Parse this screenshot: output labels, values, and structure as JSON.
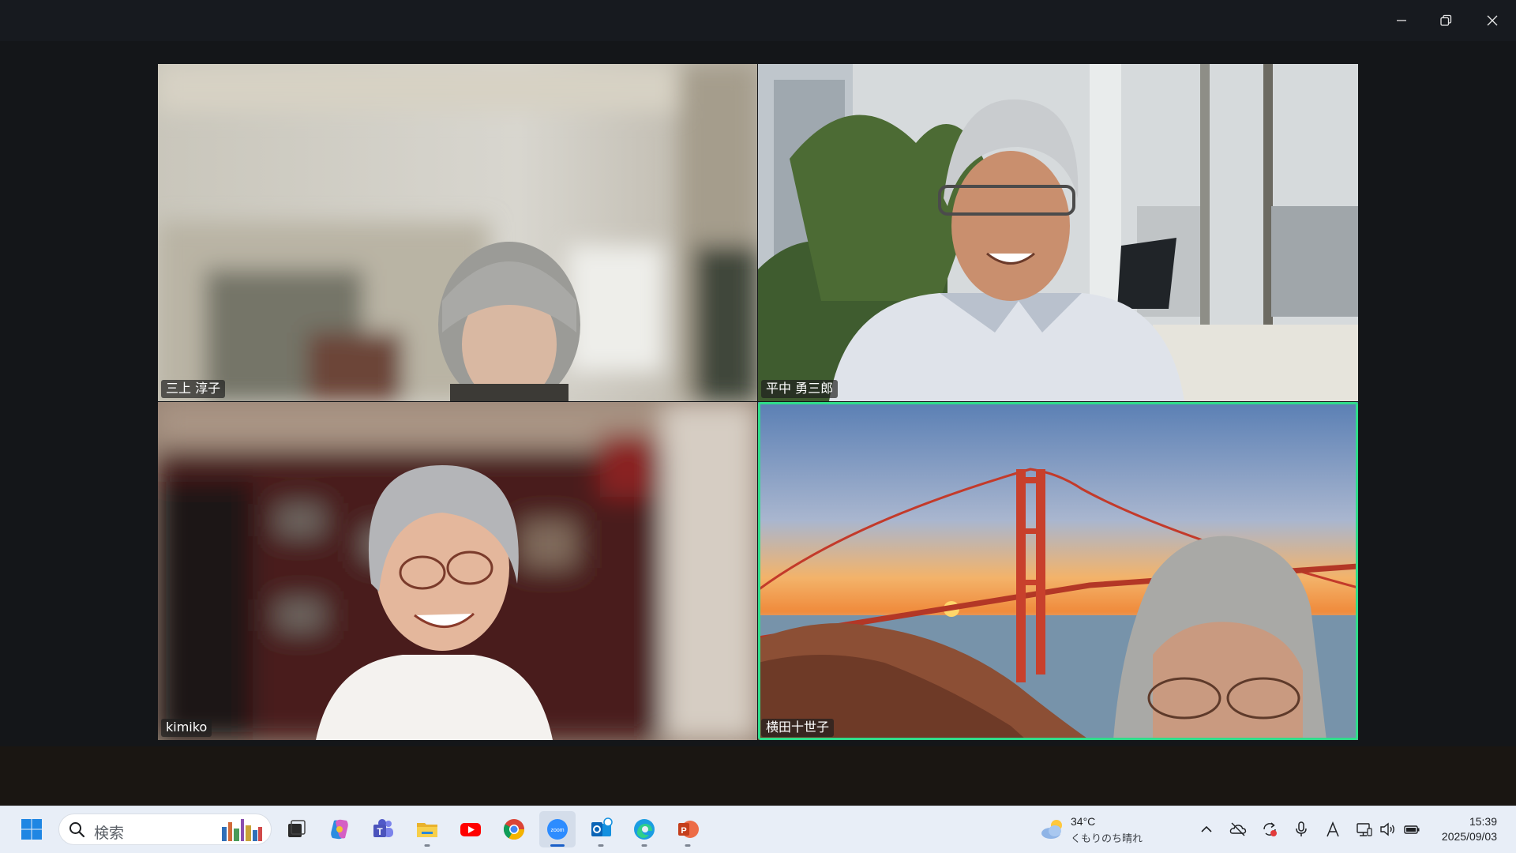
{
  "window": {
    "controls": [
      "minimize-icon",
      "restore-icon",
      "close-icon"
    ]
  },
  "participants": [
    {
      "name": "三上 淳子",
      "active_speaker": false
    },
    {
      "name": "平中 勇三郎",
      "active_speaker": false
    },
    {
      "name": "kimiko",
      "active_speaker": false
    },
    {
      "name": "横田十世子",
      "active_speaker": true
    }
  ],
  "colors": {
    "active_speaker_border": "#2fdc8a",
    "taskbar_bg": "#e8eef7",
    "window_bg": "#171a1f"
  },
  "taskbar": {
    "search_placeholder": "検索",
    "apps": [
      "windows-start-icon",
      "task-view-icon",
      "copilot-icon",
      "teams-icon",
      "file-explorer-icon",
      "youtube-icon",
      "chrome-icon",
      "zoom-icon",
      "outlook-icon",
      "edge-icon",
      "powerpoint-icon"
    ],
    "active_app": "zoom-icon",
    "weather": {
      "temp": "34°C",
      "desc": "くもりのち晴れ"
    },
    "tray": [
      "chevron-up-icon",
      "onedrive-offline-icon",
      "sync-icon",
      "microphone-icon",
      "ime-a-icon",
      "network-icon",
      "volume-icon",
      "battery-icon"
    ],
    "clock": {
      "time": "15:39",
      "date": "2025/09/03"
    }
  }
}
